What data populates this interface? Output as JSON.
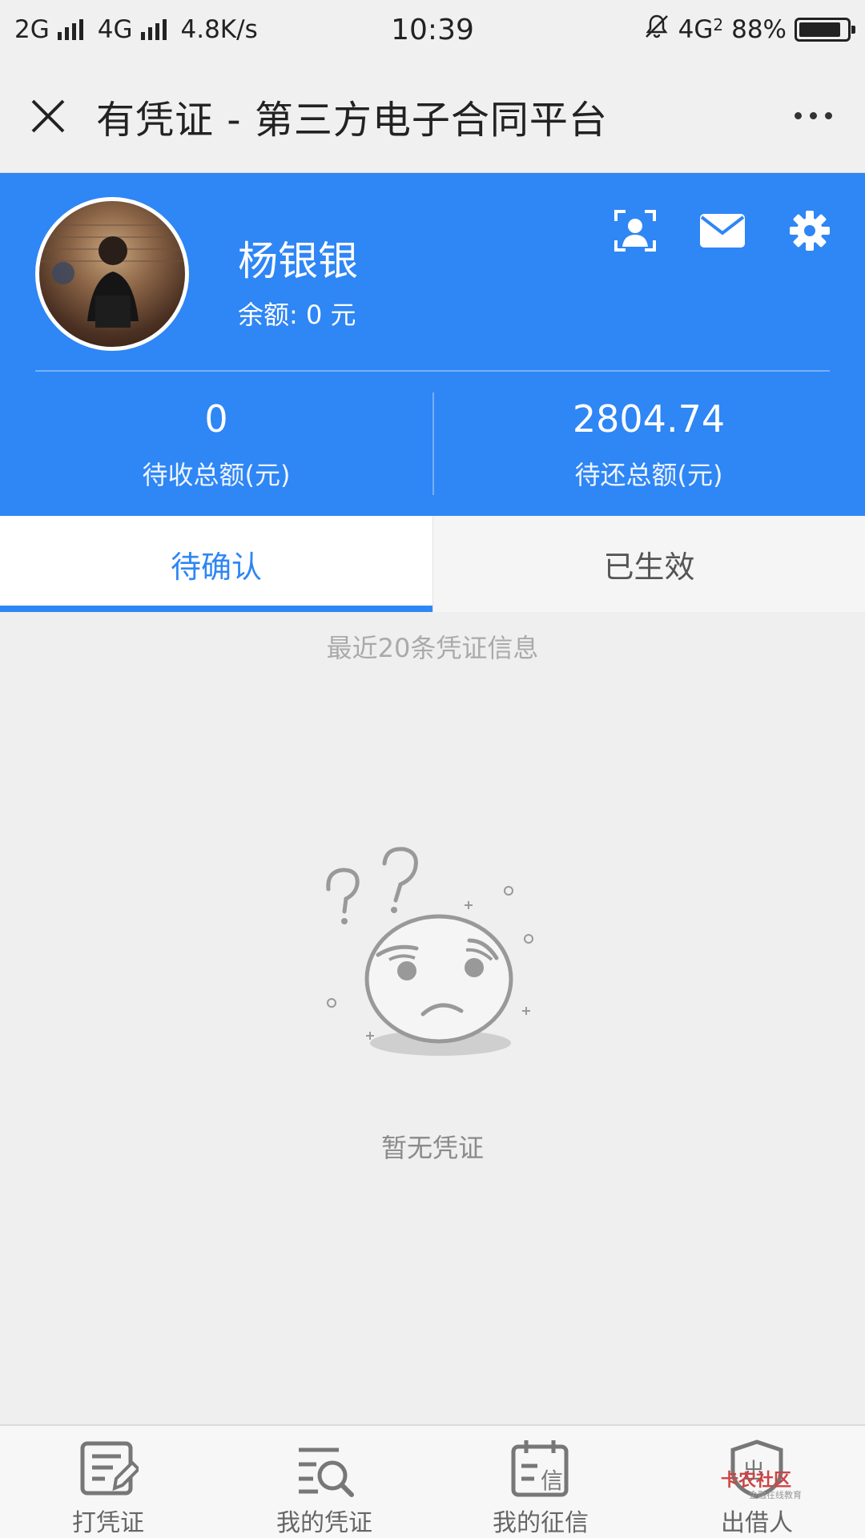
{
  "status_bar": {
    "left_text_1": "2G",
    "left_text_2": "4G",
    "speed": "4.8K/s",
    "time": "10:39",
    "network_right": "4G",
    "network_sub": "2",
    "battery_percent_text": "88%",
    "battery_level": 0.88
  },
  "title_bar": {
    "title": "有凭证 - 第三方电子合同平台"
  },
  "profile": {
    "name": "杨银银",
    "balance": "余额: 0 元"
  },
  "stats": [
    {
      "value": "0",
      "label": "待收总额(元)"
    },
    {
      "value": "2804.74",
      "label": "待还总额(元)"
    }
  ],
  "tabs": [
    {
      "label": "待确认",
      "active": true
    },
    {
      "label": "已生效",
      "active": false
    }
  ],
  "recent_note": "最近20条凭证信息",
  "empty_state": {
    "text": "暂无凭证"
  },
  "bottom_nav": [
    {
      "label": "打凭证",
      "icon": "pen-document-icon"
    },
    {
      "label": "我的凭证",
      "icon": "list-search-icon"
    },
    {
      "label": "我的征信",
      "icon": "calendar-credit-icon"
    },
    {
      "label": "出借人",
      "icon": "shield-lender-icon"
    }
  ],
  "watermark": {
    "main": "卡农社区",
    "sub": "金融在线教育"
  },
  "colors": {
    "accent": "#2f86f5",
    "background": "#efefef"
  }
}
